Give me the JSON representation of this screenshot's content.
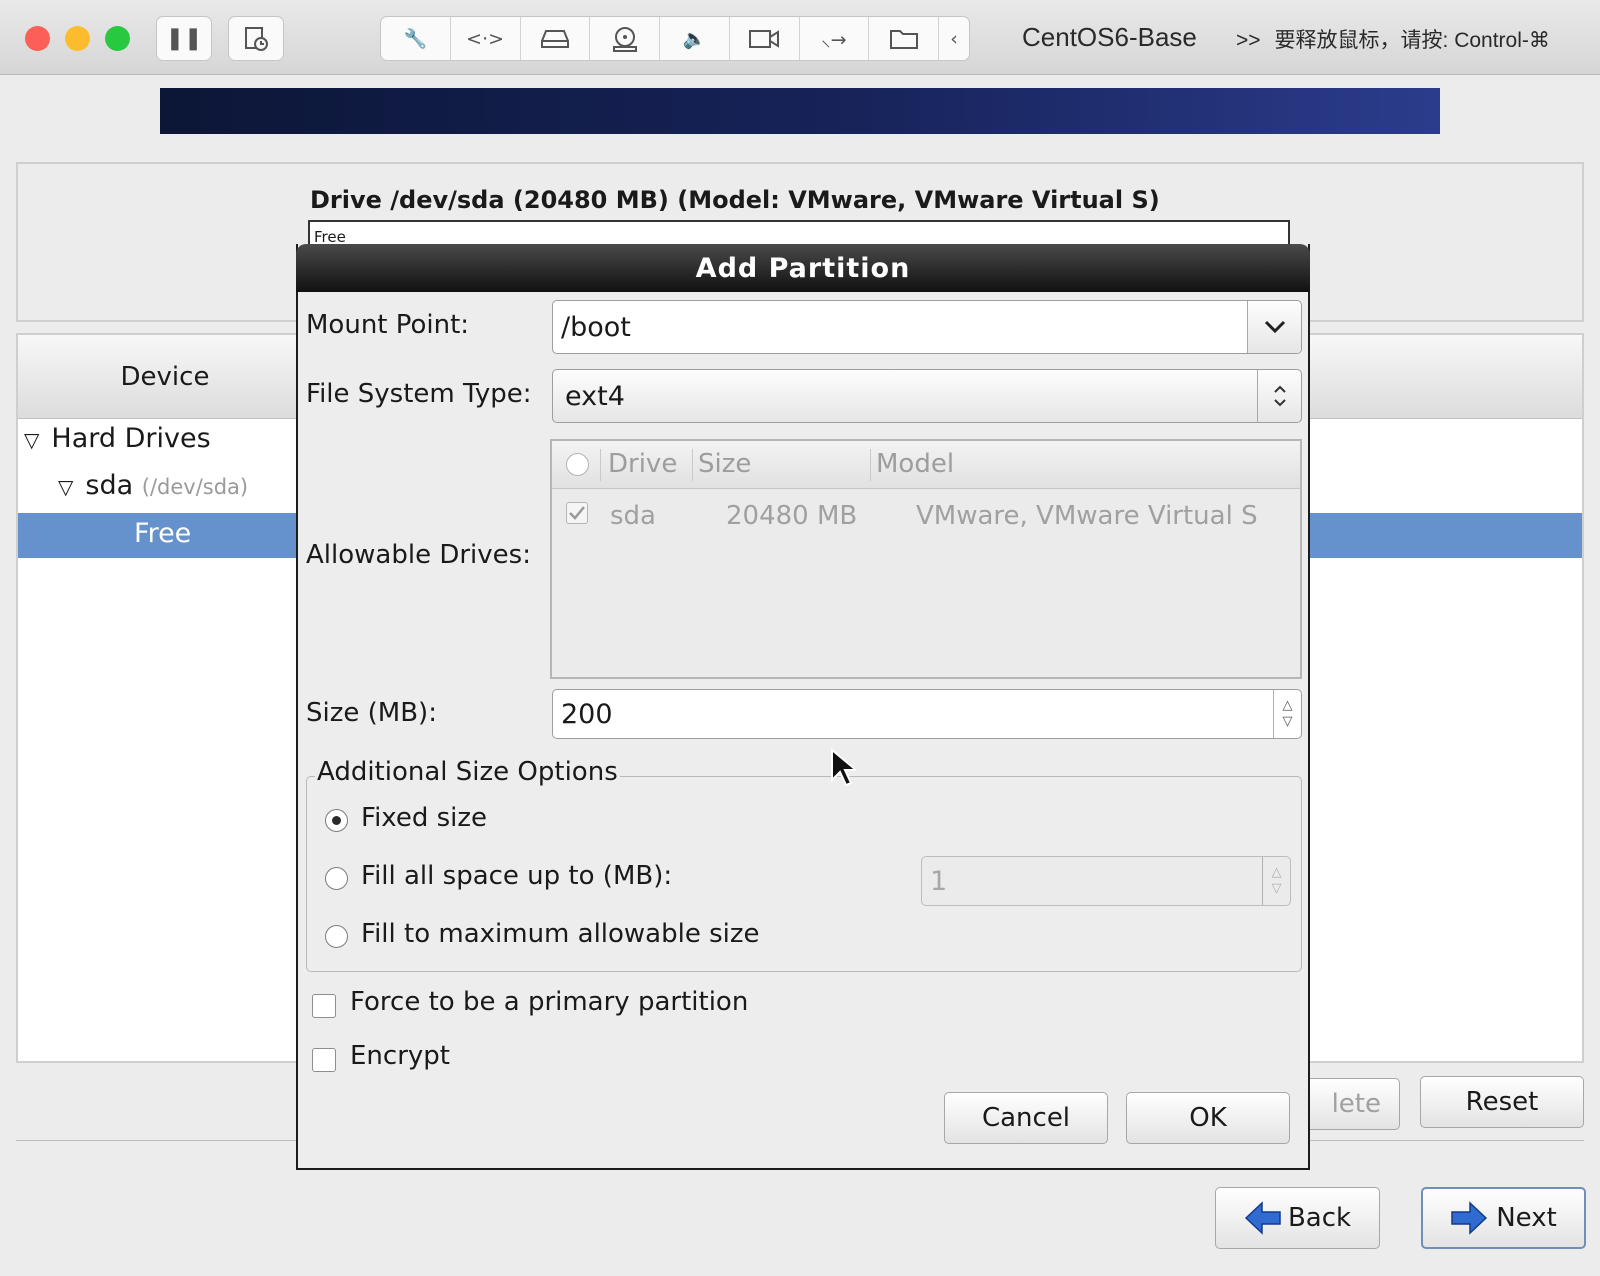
{
  "host": {
    "vm_title": "CentOS6-Base",
    "release_hint": "要释放鼠标，请按: Control-⌘",
    "chevrons": ">>"
  },
  "installer": {
    "drive_heading": "Drive /dev/sda (20480 MB) (Model: VMware, VMware Virtual S)",
    "drive_bar_label": "Free",
    "device_column": "Device",
    "tree": {
      "hard_drives": "Hard Drives",
      "sda": "sda",
      "sda_path": "(/dev/sda)",
      "free": "Free"
    },
    "delete_label": "lete",
    "reset_label": "Reset",
    "back_label": "Back",
    "next_label": "Next"
  },
  "dialog": {
    "title": "Add Partition",
    "mount_point_label": "Mount Point:",
    "mount_point_value": "/boot",
    "fs_type_label": "File System Type:",
    "fs_type_value": "ext4",
    "allowable_label": "Allowable Drives:",
    "drives_columns": [
      "Drive",
      "Size",
      "Model"
    ],
    "drives_rows": [
      {
        "checked": true,
        "drive": "sda",
        "size": "20480 MB",
        "model": "VMware, VMware Virtual S"
      }
    ],
    "size_label": "Size (MB):",
    "size_value": "200",
    "size_group_title": "Additional Size Options",
    "opt_fixed": "Fixed size",
    "opt_fill_upto": "Fill all space up to (MB):",
    "fill_upto_value": "1",
    "opt_fill_max": "Fill to maximum allowable size",
    "selected_option": "Fixed size",
    "force_primary": "Force to be a primary partition",
    "force_primary_checked": false,
    "encrypt": "Encrypt",
    "encrypt_checked": false,
    "cancel_label": "Cancel",
    "ok_label": "OK"
  },
  "colors": {
    "selection": "#6591cd",
    "arrow_blue": "#2f6bd0",
    "close": "#fc5f57",
    "minimize": "#fdbc2e",
    "zoom": "#28c840"
  }
}
